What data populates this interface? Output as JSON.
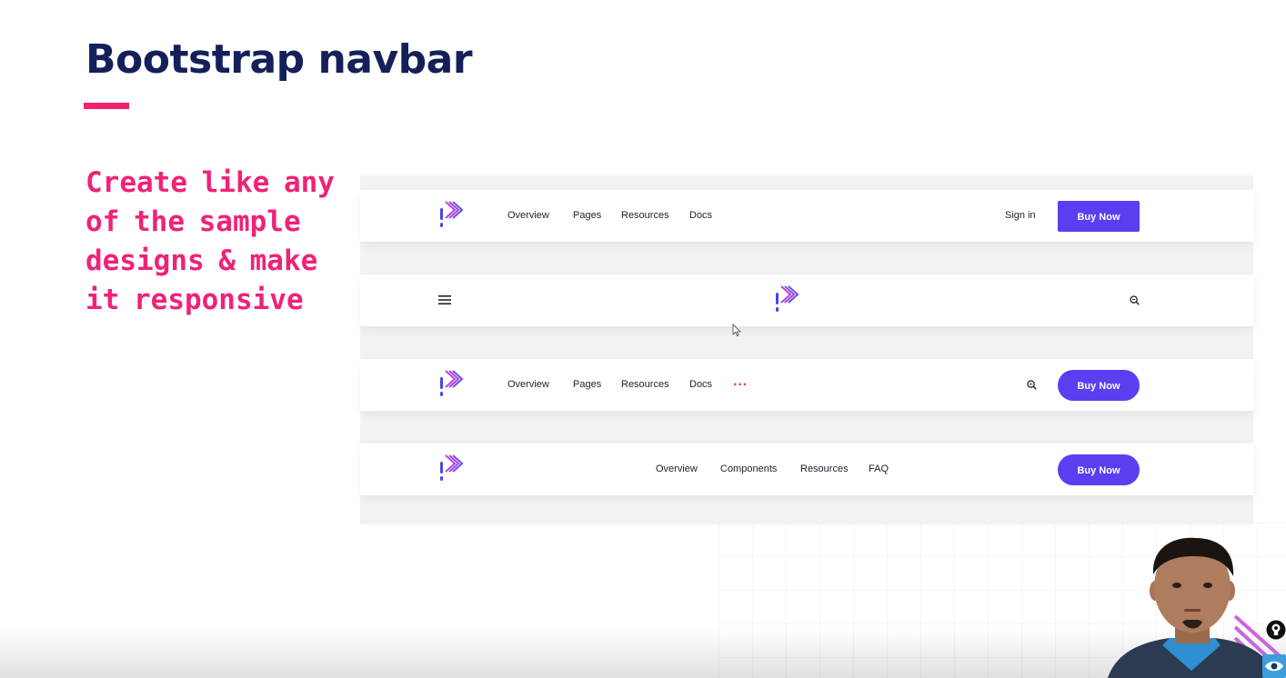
{
  "slide": {
    "title": "Bootstrap navbar",
    "note": "Create like any of the sample designs & make it responsive"
  },
  "colors": {
    "title": "#14205a",
    "accent": "#f01f70",
    "note": "#ef2278",
    "button": "#5a3ff0",
    "logo_bar": "#4b46e8",
    "logo_chevron": "#c23fd8",
    "dots": "#e0473a"
  },
  "navbar_1": {
    "links": [
      "Overview",
      "Pages",
      "Resources",
      "Docs"
    ],
    "sign_in": "Sign in",
    "cta": "Buy Now"
  },
  "navbar_2": {
    "menu_icon": "hamburger-menu-icon",
    "search_icon": "search-icon"
  },
  "navbar_3": {
    "links": [
      "Overview",
      "Pages",
      "Resources",
      "Docs"
    ],
    "more_icon": "more-dots-icon",
    "search_icon": "search-icon",
    "cta": "Buy Now"
  },
  "navbar_4": {
    "links": [
      "Overview",
      "Components",
      "Resources",
      "FAQ"
    ],
    "cta": "Buy Now"
  },
  "overlay": {
    "icons": [
      "lightbulb-icon",
      "eye-icon"
    ]
  }
}
